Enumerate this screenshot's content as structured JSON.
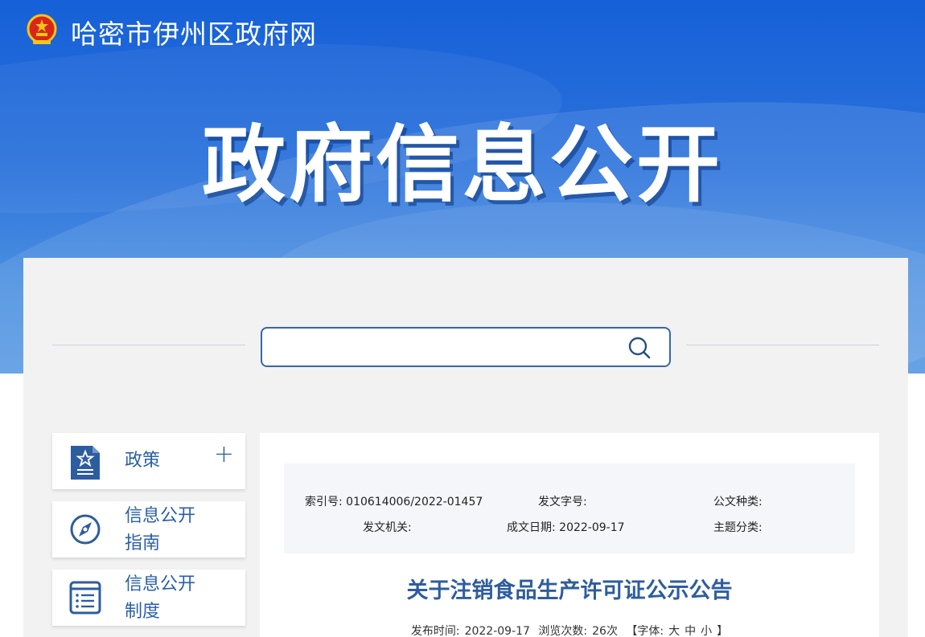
{
  "header": {
    "site_name": "哈密市伊州区政府网",
    "banner_title": "政府信息公开"
  },
  "search": {
    "placeholder": "",
    "value": ""
  },
  "sidebar": {
    "items": [
      {
        "label": "政策",
        "icon": "policy-document-icon",
        "expandable": true
      },
      {
        "label_line1": "信息公开",
        "label_line2": "指南",
        "icon": "compass-icon"
      },
      {
        "label_line1": "信息公开",
        "label_line2": "制度",
        "icon": "list-document-icon"
      }
    ]
  },
  "meta": {
    "index_no_label": "索引号:",
    "index_no_value": "010614006/2022-01457",
    "doc_no_label": "发文字号:",
    "doc_type_label": "公文种类:",
    "issuer_label": "发文机关:",
    "created_date_label": "成文日期:",
    "created_date_value": "2022-09-17",
    "topic_label": "主题分类:"
  },
  "article": {
    "title": "关于注销食品生产许可证公示公告",
    "publish_label": "发布时间:",
    "publish_date": "2022-09-17",
    "views_label": "浏览次数:",
    "views_value": "26次",
    "font_prefix": "【字体:",
    "font_large": "大",
    "font_medium": "中",
    "font_small": "小",
    "font_suffix": "】"
  },
  "colors": {
    "brand_blue": "#1660d8",
    "accent_text": "#2a5fa8",
    "title_text": "#2e5d9f",
    "panel_bg": "#f2f2f2"
  }
}
